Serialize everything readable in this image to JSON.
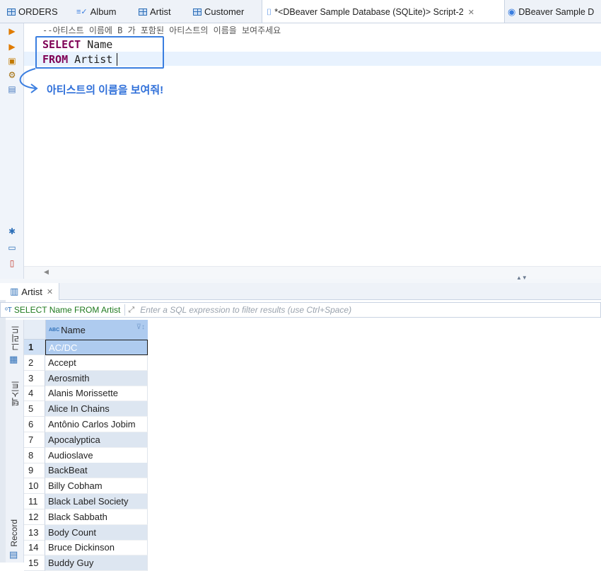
{
  "tabs": [
    {
      "label": "ORDERS",
      "icon": "table-icon"
    },
    {
      "label": "Album",
      "icon": "view-icon"
    },
    {
      "label": "Artist",
      "icon": "table-icon"
    },
    {
      "label": "Customer",
      "icon": "table-icon"
    },
    {
      "label": "*<DBeaver Sample Database (SQLite)> Script-2",
      "icon": "sql-script-icon",
      "active": true
    },
    {
      "label": "DBeaver Sample D",
      "icon": "database-icon"
    }
  ],
  "editor": {
    "comment": "--아티스트 이름에 B  가 포함된 아티스트의 이름을 보여주세요",
    "line1_keyword": "SELECT",
    "line1_rest": " Name",
    "line2_keyword": "FROM",
    "line2_rest": " Artist",
    "annotation": "아티스트의 이름을 보여줘!"
  },
  "results": {
    "tab_label": "Artist",
    "filter_sql": "SELECT Name FROM Artist",
    "filter_placeholder": "Enter a SQL expression to filter results (use Ctrl+Space)",
    "side_grid_label": "그리드",
    "side_text_label": "텍스트",
    "side_record_label": "Record",
    "column_header": "Name",
    "column_type_badge": "ABC",
    "rows": [
      {
        "num": "1",
        "name": "AC/DC"
      },
      {
        "num": "2",
        "name": "Accept"
      },
      {
        "num": "3",
        "name": "Aerosmith"
      },
      {
        "num": "4",
        "name": "Alanis Morissette"
      },
      {
        "num": "5",
        "name": "Alice In Chains"
      },
      {
        "num": "6",
        "name": "Antônio Carlos Jobim"
      },
      {
        "num": "7",
        "name": "Apocalyptica"
      },
      {
        "num": "8",
        "name": "Audioslave"
      },
      {
        "num": "9",
        "name": "BackBeat"
      },
      {
        "num": "10",
        "name": "Billy Cobham"
      },
      {
        "num": "11",
        "name": "Black Label Society"
      },
      {
        "num": "12",
        "name": "Black Sabbath"
      },
      {
        "num": "13",
        "name": "Body Count"
      },
      {
        "num": "14",
        "name": "Bruce Dickinson"
      },
      {
        "num": "15",
        "name": "Buddy Guy"
      }
    ]
  },
  "colors": {
    "keyword": "#7f0055",
    "annotation": "#2f6fd9",
    "selection": "#aecbef"
  }
}
